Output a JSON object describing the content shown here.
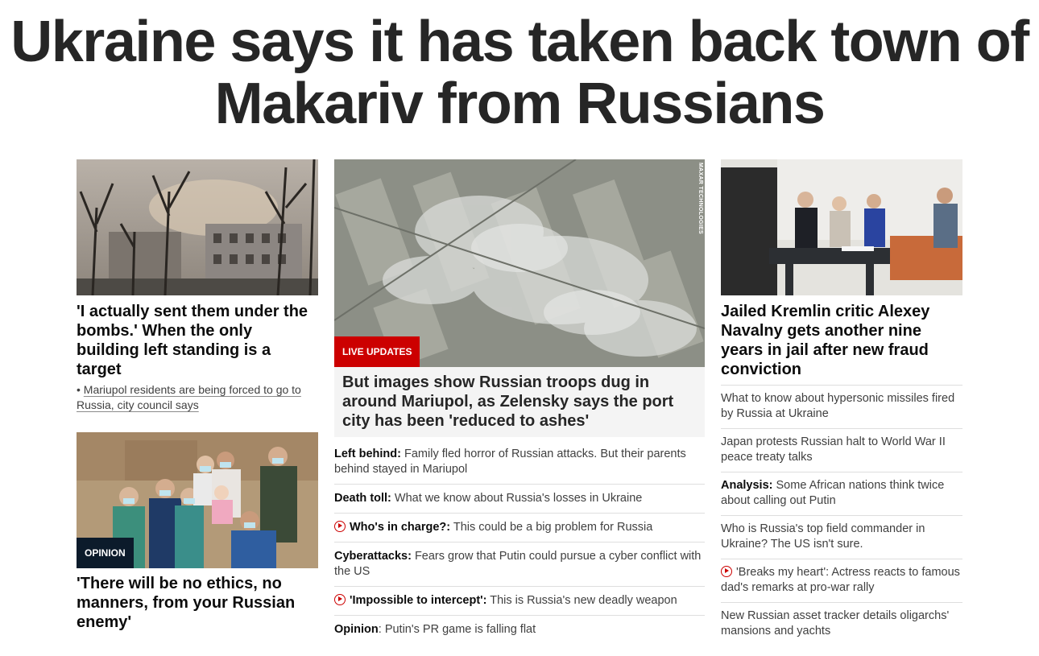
{
  "headline": "Ukraine says it has taken back town of Makariv from Russians",
  "left": {
    "story1": {
      "title": "'I actually sent them under the bombs.' When the only building left standing is a target",
      "bullet": "Mariupol residents are being forced to go to Russia, city council says"
    },
    "story2": {
      "badge": "OPINION",
      "title": "'There will be no ethics, no manners, from your Russian enemy'"
    }
  },
  "middle": {
    "badge": "LIVE UPDATES",
    "watermark": "MAXAR TECHNOLOGIES",
    "title": "But images show Russian troops dug in around Mariupol, as Zelensky says the port city has been 'reduced to ashes'",
    "items": [
      {
        "bold": "Left behind:",
        "text": " Family fled horror of Russian attacks. But their parents behind stayed in Mariupol",
        "video": false
      },
      {
        "bold": "Death toll:",
        "text": " What we know about Russia's losses in Ukraine",
        "video": false
      },
      {
        "bold": "Who's in charge?:",
        "text": " This could be a big problem for Russia",
        "video": true
      },
      {
        "bold": "Cyberattacks:",
        "text": " Fears grow that Putin could pursue a cyber conflict with the US",
        "video": false
      },
      {
        "bold": "'Impossible to intercept':",
        "text": " This is Russia's new deadly weapon",
        "video": true
      },
      {
        "bold": "Opinion",
        "text": ": Putin's PR game is falling flat",
        "video": false
      }
    ]
  },
  "right": {
    "title": "Jailed Kremlin critic Alexey Navalny gets another nine years in jail after new fraud conviction",
    "items": [
      {
        "bold": "",
        "text": "What to know about hypersonic missiles fired by Russia at Ukraine",
        "video": false
      },
      {
        "bold": "",
        "text": "Japan protests Russian halt to World War II peace treaty talks",
        "video": false
      },
      {
        "bold": "Analysis:",
        "text": " Some African nations think twice about calling out Putin",
        "video": false
      },
      {
        "bold": "",
        "text": "Who is Russia's top field commander in Ukraine? The US isn't sure.",
        "video": false
      },
      {
        "bold": "",
        "text": "'Breaks my heart': Actress reacts to famous dad's remarks at pro-war rally",
        "video": true
      },
      {
        "bold": "",
        "text": "New Russian asset tracker details oligarchs' mansions and yachts",
        "video": false
      }
    ]
  },
  "icons": {
    "video": "play-circle-icon"
  },
  "colors": {
    "live": "#cc0000",
    "opinion": "#0c1b2b",
    "headline": "#262626"
  }
}
